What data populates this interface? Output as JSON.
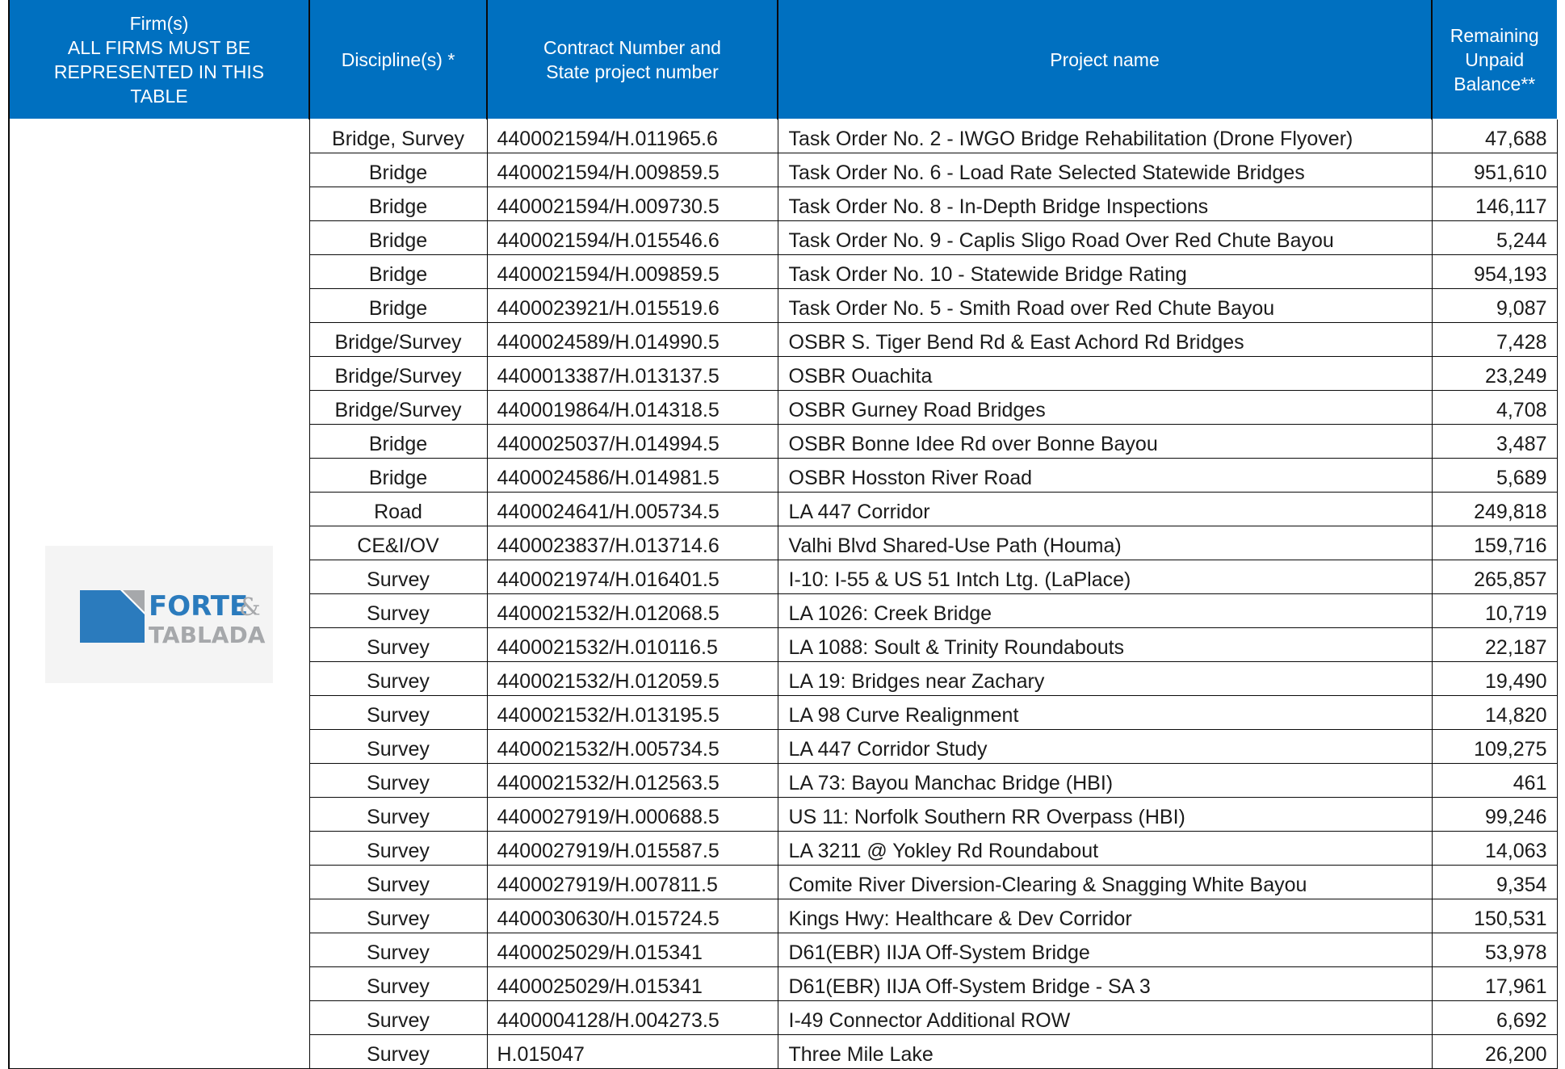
{
  "table": {
    "headers": {
      "firm_line1": "Firm(s)",
      "firm_line2": "ALL FIRMS MUST BE REPRESENTED IN THIS TABLE",
      "discipline": "Discipline(s) *",
      "contract": "Contract Number and State project number",
      "project": "Project name",
      "balance": "Remaining Unpaid Balance**"
    },
    "firm_logo": {
      "text_line1": "FORTE",
      "ampersand": "&",
      "text_line2": "TABLADA",
      "colors": {
        "blue": "#2b7bbd",
        "gray": "#a6a8ab",
        "navy": "#1f4e79"
      }
    },
    "rows": [
      {
        "discipline": "Bridge, Survey",
        "contract": "4400021594/H.011965.6",
        "project": "Task Order No. 2 - IWGO Bridge Rehabilitation (Drone Flyover)",
        "balance": "47,688"
      },
      {
        "discipline": "Bridge",
        "contract": "4400021594/H.009859.5",
        "project": "Task Order No. 6 - Load Rate Selected Statewide Bridges",
        "balance": "951,610"
      },
      {
        "discipline": "Bridge",
        "contract": "4400021594/H.009730.5",
        "project": "Task Order No. 8 - In-Depth Bridge Inspections",
        "balance": "146,117"
      },
      {
        "discipline": "Bridge",
        "contract": "4400021594/H.015546.6",
        "project": "Task Order No. 9 - Caplis Sligo Road Over Red Chute Bayou",
        "balance": "5,244"
      },
      {
        "discipline": "Bridge",
        "contract": "4400021594/H.009859.5",
        "project": "Task Order No. 10 - Statewide Bridge Rating",
        "balance": "954,193"
      },
      {
        "discipline": "Bridge",
        "contract": "4400023921/H.015519.6",
        "project": "Task Order No. 5 - Smith Road over Red Chute Bayou",
        "balance": "9,087"
      },
      {
        "discipline": "Bridge/Survey",
        "contract": "4400024589/H.014990.5",
        "project": "OSBR S. Tiger Bend Rd & East Achord Rd Bridges",
        "balance": "7,428"
      },
      {
        "discipline": "Bridge/Survey",
        "contract": "4400013387/H.013137.5",
        "project": "OSBR Ouachita",
        "balance": "23,249"
      },
      {
        "discipline": "Bridge/Survey",
        "contract": "4400019864/H.014318.5",
        "project": "OSBR Gurney Road Bridges",
        "balance": "4,708"
      },
      {
        "discipline": "Bridge",
        "contract": "4400025037/H.014994.5",
        "project": "OSBR Bonne Idee Rd over Bonne Bayou",
        "balance": "3,487"
      },
      {
        "discipline": "Bridge",
        "contract": "4400024586/H.014981.5",
        "project": "OSBR Hosston River Road",
        "balance": "5,689"
      },
      {
        "discipline": "Road",
        "contract": "4400024641/H.005734.5",
        "project": "LA 447 Corridor",
        "balance": "249,818"
      },
      {
        "discipline": "CE&I/OV",
        "contract": "4400023837/H.013714.6",
        "project": "Valhi Blvd Shared-Use Path (Houma)",
        "balance": "159,716"
      },
      {
        "discipline": "Survey",
        "contract": "4400021974/H.016401.5",
        "project": "I-10: I-55 & US 51 Intch Ltg. (LaPlace)",
        "balance": "265,857"
      },
      {
        "discipline": "Survey",
        "contract": "4400021532/H.012068.5",
        "project": "LA 1026: Creek Bridge",
        "balance": "10,719"
      },
      {
        "discipline": "Survey",
        "contract": "4400021532/H.010116.5",
        "project": "LA 1088: Soult & Trinity Roundabouts",
        "balance": "22,187"
      },
      {
        "discipline": "Survey",
        "contract": "4400021532/H.012059.5",
        "project": "LA 19: Bridges near Zachary",
        "balance": "19,490"
      },
      {
        "discipline": "Survey",
        "contract": "4400021532/H.013195.5",
        "project": "LA 98 Curve Realignment",
        "balance": "14,820"
      },
      {
        "discipline": "Survey",
        "contract": "4400021532/H.005734.5",
        "project": "LA 447 Corridor Study",
        "balance": "109,275"
      },
      {
        "discipline": "Survey",
        "contract": "4400021532/H.012563.5",
        "project": "LA 73: Bayou Manchac Bridge (HBI)",
        "balance": "461"
      },
      {
        "discipline": "Survey",
        "contract": "4400027919/H.000688.5",
        "project": "US 11: Norfolk Southern RR Overpass (HBI)",
        "balance": "99,246"
      },
      {
        "discipline": "Survey",
        "contract": "4400027919/H.015587.5",
        "project": "LA 3211 @ Yokley Rd Roundabout",
        "balance": "14,063"
      },
      {
        "discipline": "Survey",
        "contract": "4400027919/H.007811.5",
        "project": "Comite River Diversion-Clearing & Snagging White Bayou",
        "balance": "9,354"
      },
      {
        "discipline": "Survey",
        "contract": "4400030630/H.015724.5",
        "project": "Kings Hwy: Healthcare & Dev Corridor",
        "balance": "150,531"
      },
      {
        "discipline": "Survey",
        "contract": "4400025029/H.015341",
        "project": "D61(EBR) IIJA Off-System Bridge",
        "balance": "53,978"
      },
      {
        "discipline": "Survey",
        "contract": "4400025029/H.015341",
        "project": "D61(EBR) IIJA Off-System Bridge - SA 3",
        "balance": "17,961"
      },
      {
        "discipline": "Survey",
        "contract": "4400004128/H.004273.5",
        "project": "I-49 Connector Additional ROW",
        "balance": "6,692"
      },
      {
        "discipline": "Survey",
        "contract": "H.015047",
        "project": "Three Mile Lake",
        "balance": "26,200"
      }
    ]
  }
}
